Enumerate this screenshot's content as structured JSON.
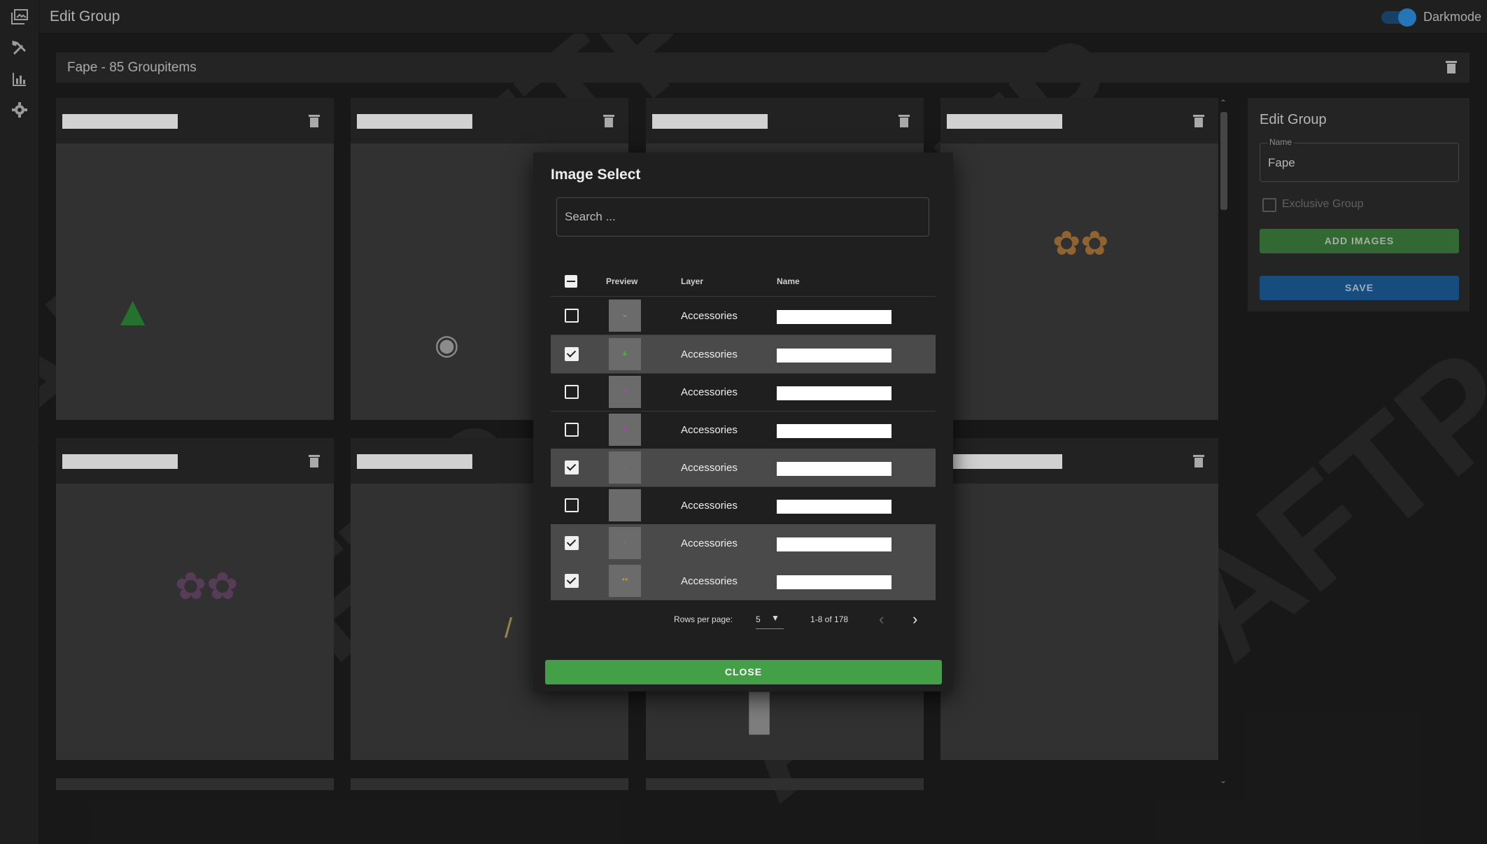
{
  "app": {
    "title": "Edit Group",
    "darkmode_label": "Darkmode",
    "darkmode_on": true
  },
  "sidenav": {
    "items": [
      {
        "icon": "gallery-icon"
      },
      {
        "icon": "tools-icon"
      },
      {
        "icon": "chart-icon"
      },
      {
        "icon": "gear-icon"
      }
    ]
  },
  "group": {
    "header": "Fape - 85 Groupitems"
  },
  "edit_panel": {
    "title": "Edit Group",
    "name_label": "Name",
    "name_value": "Fape",
    "exclusive_label": "Exclusive Group",
    "exclusive_checked": false,
    "add_images_label": "ADD IMAGES",
    "save_label": "SAVE"
  },
  "dialog": {
    "title": "Image Select",
    "search_placeholder": "Search ...",
    "columns": {
      "preview": "Preview",
      "layer": "Layer",
      "name": "Name"
    },
    "rows": [
      {
        "layer": "Accessories",
        "checked": false
      },
      {
        "layer": "Accessories",
        "checked": true
      },
      {
        "layer": "Accessories",
        "checked": false
      },
      {
        "layer": "Accessories",
        "checked": false
      },
      {
        "layer": "Accessories",
        "checked": true
      },
      {
        "layer": "Accessories",
        "checked": false
      },
      {
        "layer": "Accessories",
        "checked": true
      },
      {
        "layer": "Accessories",
        "checked": true
      }
    ],
    "pagination": {
      "rows_per_page_label": "Rows per page:",
      "rows_per_page_value": "5",
      "range": "1-8 of 178"
    },
    "close_label": "CLOSE"
  },
  "watermark": "AFTP"
}
